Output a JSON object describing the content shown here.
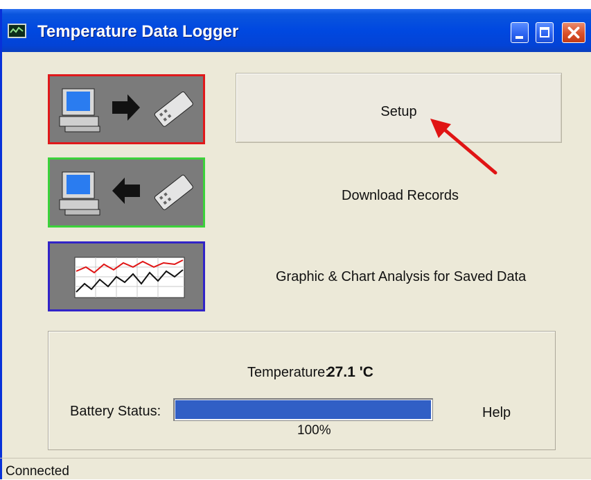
{
  "window": {
    "title": "Temperature Data Logger",
    "title_icon": "chart-app-icon",
    "controls": [
      "minimize-icon",
      "maximize-icon",
      "close-icon"
    ]
  },
  "actions": {
    "setup": {
      "label": "Setup",
      "icon": "pc-to-logger-icon",
      "border_color": "#e0191b"
    },
    "download": {
      "label": "Download Records",
      "icon": "logger-to-pc-icon",
      "border_color": "#3cd23a"
    },
    "chart": {
      "label": "Graphic & Chart Analysis for Saved Data",
      "icon": "chart-analysis-icon",
      "border_color": "#3124c8"
    }
  },
  "status_panel": {
    "temperature_label": "Temperature:",
    "temperature_value": "27.1 'C",
    "battery_label": "Battery Status:",
    "battery_percent_text": "100%",
    "battery_level": 1.0,
    "battery_color": "#315fc5",
    "help_label": "Help"
  },
  "statusbar": {
    "text": "Connected"
  },
  "annotation": {
    "arrow_color": "#e01414"
  }
}
